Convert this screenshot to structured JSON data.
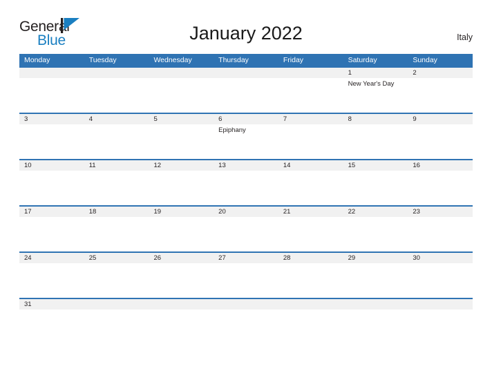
{
  "brand": {
    "name_part1": "General",
    "name_part2": "Blue",
    "flag_icon": "flag-triangle-icon",
    "color_dark": "#231f20",
    "color_blue": "#1a7fc1"
  },
  "header": {
    "title": "January 2022",
    "country": "Italy"
  },
  "theme": {
    "header_blue": "#2f73b3",
    "row_gray": "#f1f1f1",
    "text_dark": "#231f20"
  },
  "calendar": {
    "weekday_headers": [
      "Monday",
      "Tuesday",
      "Wednesday",
      "Thursday",
      "Friday",
      "Saturday",
      "Sunday"
    ],
    "weeks": [
      {
        "days": [
          {
            "num": "",
            "event": ""
          },
          {
            "num": "",
            "event": ""
          },
          {
            "num": "",
            "event": ""
          },
          {
            "num": "",
            "event": ""
          },
          {
            "num": "",
            "event": ""
          },
          {
            "num": "1",
            "event": "New Year's Day"
          },
          {
            "num": "2",
            "event": ""
          }
        ]
      },
      {
        "days": [
          {
            "num": "3",
            "event": ""
          },
          {
            "num": "4",
            "event": ""
          },
          {
            "num": "5",
            "event": ""
          },
          {
            "num": "6",
            "event": "Epiphany"
          },
          {
            "num": "7",
            "event": ""
          },
          {
            "num": "8",
            "event": ""
          },
          {
            "num": "9",
            "event": ""
          }
        ]
      },
      {
        "days": [
          {
            "num": "10",
            "event": ""
          },
          {
            "num": "11",
            "event": ""
          },
          {
            "num": "12",
            "event": ""
          },
          {
            "num": "13",
            "event": ""
          },
          {
            "num": "14",
            "event": ""
          },
          {
            "num": "15",
            "event": ""
          },
          {
            "num": "16",
            "event": ""
          }
        ]
      },
      {
        "days": [
          {
            "num": "17",
            "event": ""
          },
          {
            "num": "18",
            "event": ""
          },
          {
            "num": "19",
            "event": ""
          },
          {
            "num": "20",
            "event": ""
          },
          {
            "num": "21",
            "event": ""
          },
          {
            "num": "22",
            "event": ""
          },
          {
            "num": "23",
            "event": ""
          }
        ]
      },
      {
        "days": [
          {
            "num": "24",
            "event": ""
          },
          {
            "num": "25",
            "event": ""
          },
          {
            "num": "26",
            "event": ""
          },
          {
            "num": "27",
            "event": ""
          },
          {
            "num": "28",
            "event": ""
          },
          {
            "num": "29",
            "event": ""
          },
          {
            "num": "30",
            "event": ""
          }
        ]
      },
      {
        "days": [
          {
            "num": "31",
            "event": ""
          },
          {
            "num": "",
            "event": ""
          },
          {
            "num": "",
            "event": ""
          },
          {
            "num": "",
            "event": ""
          },
          {
            "num": "",
            "event": ""
          },
          {
            "num": "",
            "event": ""
          },
          {
            "num": "",
            "event": ""
          }
        ]
      }
    ]
  }
}
